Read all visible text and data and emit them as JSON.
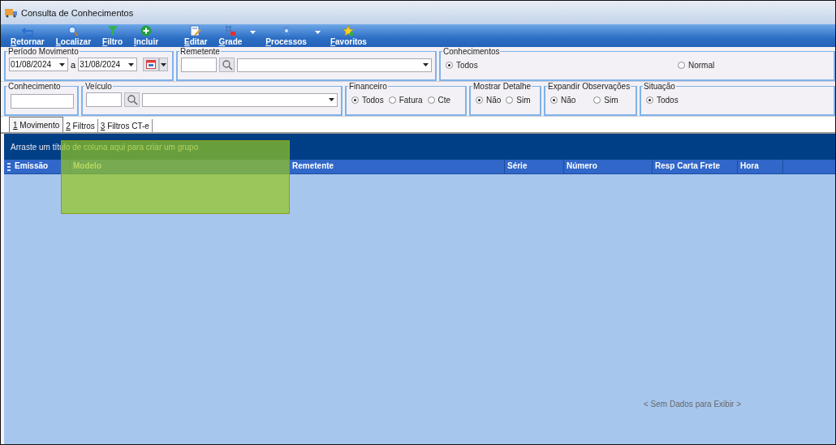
{
  "window": {
    "title": "Consulta de Conhecimentos"
  },
  "toolbar": [
    {
      "label": "Retornar",
      "kind": "undo",
      "dropdown": false
    },
    {
      "label": "Localizar",
      "kind": "search",
      "dropdown": false
    },
    {
      "label": "Filtro",
      "kind": "filter",
      "dropdown": false
    },
    {
      "label": "Incluir",
      "kind": "add",
      "dropdown": false
    },
    {
      "label": "Editar",
      "kind": "edit",
      "dropdown": false
    },
    {
      "label": "Grade",
      "kind": "grid",
      "dropdown": true
    },
    {
      "label": "Processos",
      "kind": "gear",
      "dropdown": true
    },
    {
      "label": "Favoritos",
      "kind": "star",
      "dropdown": false
    }
  ],
  "periodo": {
    "legend": "Período Movimento",
    "from": "01/08/2024",
    "separator": "a",
    "to": "31/08/2024"
  },
  "remetente": {
    "legend": "Remetente"
  },
  "conhecimentos": {
    "legend": "Conhecimentos",
    "options": [
      {
        "label": "Todos",
        "selected": true
      },
      {
        "label": "Normal",
        "selected": false
      }
    ]
  },
  "conhecimento": {
    "legend": "Conhecimento"
  },
  "veiculo": {
    "legend": "Veículo"
  },
  "financeiro": {
    "legend": "Financeiro",
    "options": [
      {
        "label": "Todos",
        "selected": true
      },
      {
        "label": "Fatura",
        "selected": false
      },
      {
        "label": "Cte",
        "selected": false
      }
    ]
  },
  "mostrar_detalhe": {
    "legend": "Mostrar Detalhe",
    "options": [
      {
        "label": "Não",
        "selected": true
      },
      {
        "label": "Sim",
        "selected": false
      }
    ]
  },
  "expandir_observacoes": {
    "legend": "Expandir Observações",
    "options": [
      {
        "label": "Não",
        "selected": true
      },
      {
        "label": "Sim",
        "selected": false
      }
    ]
  },
  "situacao": {
    "legend": "Situação",
    "options": [
      {
        "label": "Todos",
        "selected": true
      }
    ]
  },
  "tabs": [
    {
      "key": "1",
      "label": " Movimento",
      "selected": true
    },
    {
      "key": "2",
      "label": " Filtros",
      "selected": false
    },
    {
      "key": "3",
      "label": " Filtros CT-e",
      "selected": false
    }
  ],
  "grid": {
    "group_hint": "Arraste um título de coluna aqui para criar um grupo",
    "columns": [
      "Emissão",
      "Modelo",
      "Remetente",
      "Série",
      "Número",
      "Resp Carta Frete",
      "Hora"
    ],
    "empty_text": "< Sem Dados para Exibir >"
  }
}
